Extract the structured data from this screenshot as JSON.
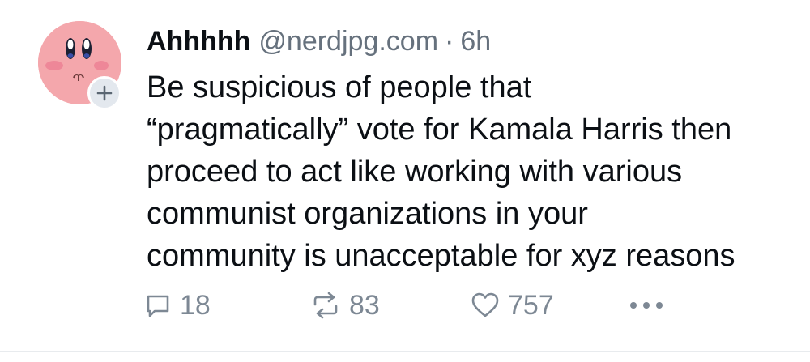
{
  "post": {
    "author": {
      "display_name": "Ahhhhh",
      "handle": "@nerdjpg.com",
      "separator": "·",
      "time": "6h",
      "avatar_icon": "kirby-avatar-icon",
      "follow_icon": "plus-icon"
    },
    "text_lines": [
      "Be suspicious of people that",
      "“pragmatically” vote for Kamala Harris then",
      "proceed to act like working with various",
      "communist organizations in your",
      "community is unacceptable for xyz reasons"
    ],
    "actions": {
      "reply_count": "18",
      "repost_count": "83",
      "like_count": "757",
      "reply_icon": "reply-bubble-icon",
      "repost_icon": "repost-icon",
      "like_icon": "heart-icon",
      "more_icon": "more-dots-icon"
    }
  },
  "colors": {
    "text": "#0b0f14",
    "muted": "#66717d",
    "action": "#7d8894",
    "avatar_bg": "#f4a7ac",
    "follow_bg": "#e3e8ee"
  }
}
